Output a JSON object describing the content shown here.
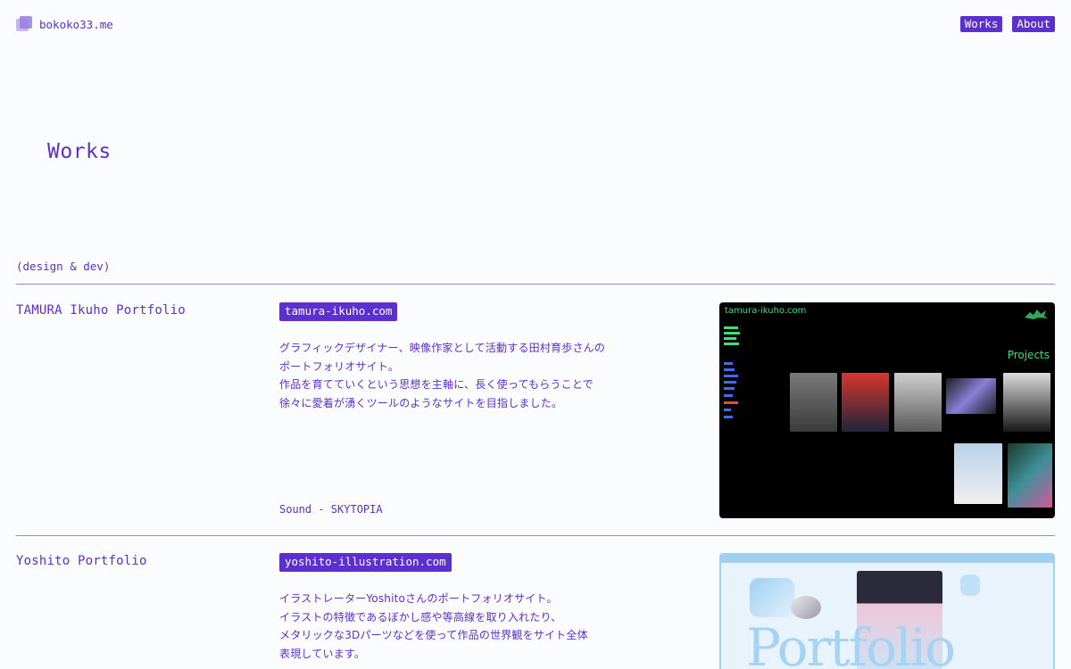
{
  "header": {
    "site_name": "bokoko33.me",
    "nav": [
      {
        "label": "Works"
      },
      {
        "label": "About"
      }
    ]
  },
  "page_title": "Works",
  "section_label": "(design & dev)",
  "works": [
    {
      "title": "TAMURA Ikuho Portfolio",
      "link": "tamura-ikuho.com",
      "description": [
        "グラフィックデザイナー、映像作家として活動する田村育歩さんの",
        "ポートフォリオサイト。",
        "作品を育てていくという思想を主軸に、長く使ってもらうことで",
        "徐々に愛着が湧くツールのようなサイトを目指しました。"
      ],
      "credit": "Sound - SKYTOPIA",
      "thumbnail": {
        "site_text": "tamura-ikuho.com",
        "heading": "Projects"
      }
    },
    {
      "title": "Yoshito Portfolio",
      "link": "yoshito-illustration.com",
      "description": [
        "イラストレーターYoshitoさんのポートフォリオサイト。",
        "イラストの特徴であるぼかし感や等高線を取り入れたり、",
        "メタリックな3Dパーツなどを使って作品の世界観をサイト全体",
        "表現しています。"
      ],
      "thumbnail": {
        "big_text": "Portfolio"
      }
    }
  ],
  "colors": {
    "accent": "#5b2fd0",
    "background": "#fbfcfd",
    "rule": "#9b83e3",
    "thumb_green": "#3be07a",
    "thumb_blue": "#9fd0f2"
  }
}
